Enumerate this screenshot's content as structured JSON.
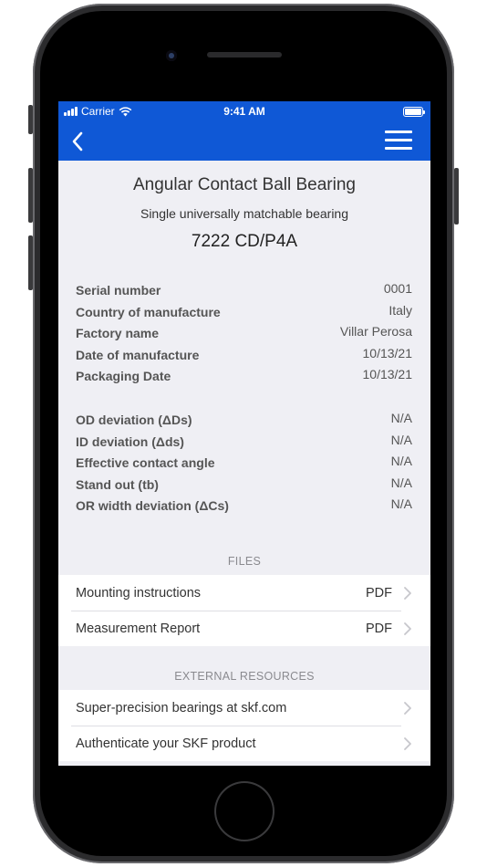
{
  "status_bar": {
    "carrier": "Carrier",
    "time": "9:41 AM"
  },
  "nav": {
    "back_icon": "chevron-left-icon",
    "menu_icon": "hamburger-menu-icon"
  },
  "product": {
    "title": "Angular Contact Ball Bearing",
    "subtitle": "Single universally matchable bearing",
    "model": "7222 CD/P4A"
  },
  "details": [
    {
      "label": "Serial number",
      "value": "0001"
    },
    {
      "label": "Country of manufacture",
      "value": "Italy"
    },
    {
      "label": "Factory name",
      "value": "Villar Perosa"
    },
    {
      "label": "Date of manufacture",
      "value": "10/13/21"
    },
    {
      "label": "Packaging Date",
      "value": "10/13/21"
    }
  ],
  "deviations": [
    {
      "label": "OD deviation (ΔDs)",
      "value": "N/A"
    },
    {
      "label": "ID deviation (Δds)",
      "value": "N/A"
    },
    {
      "label": "Effective contact angle",
      "value": "N/A"
    },
    {
      "label": "Stand out (tb)",
      "value": "N/A"
    },
    {
      "label": "OR width deviation (ΔCs)",
      "value": "N/A"
    }
  ],
  "files": {
    "header": "FILES",
    "items": [
      {
        "label": "Mounting instructions",
        "type": "PDF"
      },
      {
        "label": "Measurement Report",
        "type": "PDF"
      }
    ]
  },
  "resources": {
    "header": "EXTERNAL RESOURCES",
    "items": [
      {
        "label": "Super-precision bearings at skf.com"
      },
      {
        "label": "Authenticate your SKF product"
      }
    ]
  },
  "colors": {
    "brand_blue": "#0f58d6",
    "background": "#efeff4",
    "chevron": "#c7c7cc"
  }
}
